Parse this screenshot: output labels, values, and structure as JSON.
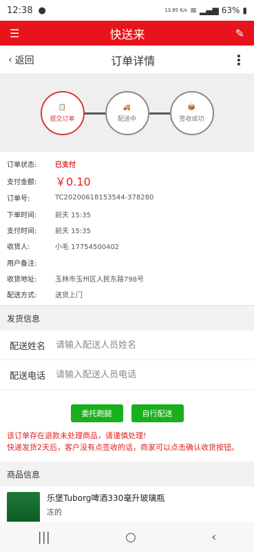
{
  "status_bar": {
    "time": "12:38",
    "speed": "13.85 K/s",
    "battery": "63%"
  },
  "app": {
    "title": "快送来"
  },
  "nav": {
    "back": "返回",
    "title": "订单详情"
  },
  "steps": [
    {
      "label": "提交订单"
    },
    {
      "label": "配送中"
    },
    {
      "label": "签收成功"
    }
  ],
  "order": {
    "status_label": "订单状态:",
    "status": "已支付",
    "amount_label": "支付金额:",
    "amount": "￥0.10",
    "no_label": "订单号:",
    "no": "TC20200618153544-378280",
    "order_time_label": "下单时间:",
    "order_time": "前天 15:35",
    "pay_time_label": "支付时间:",
    "pay_time": "前天 15:35",
    "receiver_label": "收货人:",
    "receiver": "小毛 17754500402",
    "remark_label": "用户备注:",
    "remark": "",
    "address_label": "收货地址:",
    "address": "玉林市玉州区人民东路798号",
    "delivery_label": "配送方式:",
    "delivery": "送货上门"
  },
  "shipping": {
    "title": "发货信息",
    "name_label": "配送姓名",
    "name_placeholder": "请输入配送人员姓名",
    "phone_label": "配送电话",
    "phone_placeholder": "请输入配送人员电话"
  },
  "actions": {
    "delegate": "委托跑腿",
    "self": "自行配送"
  },
  "notice": {
    "line1": "该订单存在退款未处理商品，请谨慎处理!",
    "line2": "快递发货2天后，客户没有点签收的话，商家可以点击确认收货按钮。"
  },
  "products": {
    "title": "商品信息",
    "item_name": "乐堡Tuborg啤酒330毫升玻璃瓶",
    "item_sub": "冻的"
  },
  "colors": {
    "brand": "#e8141c",
    "green": "#1ab01c",
    "alert": "#d22"
  }
}
